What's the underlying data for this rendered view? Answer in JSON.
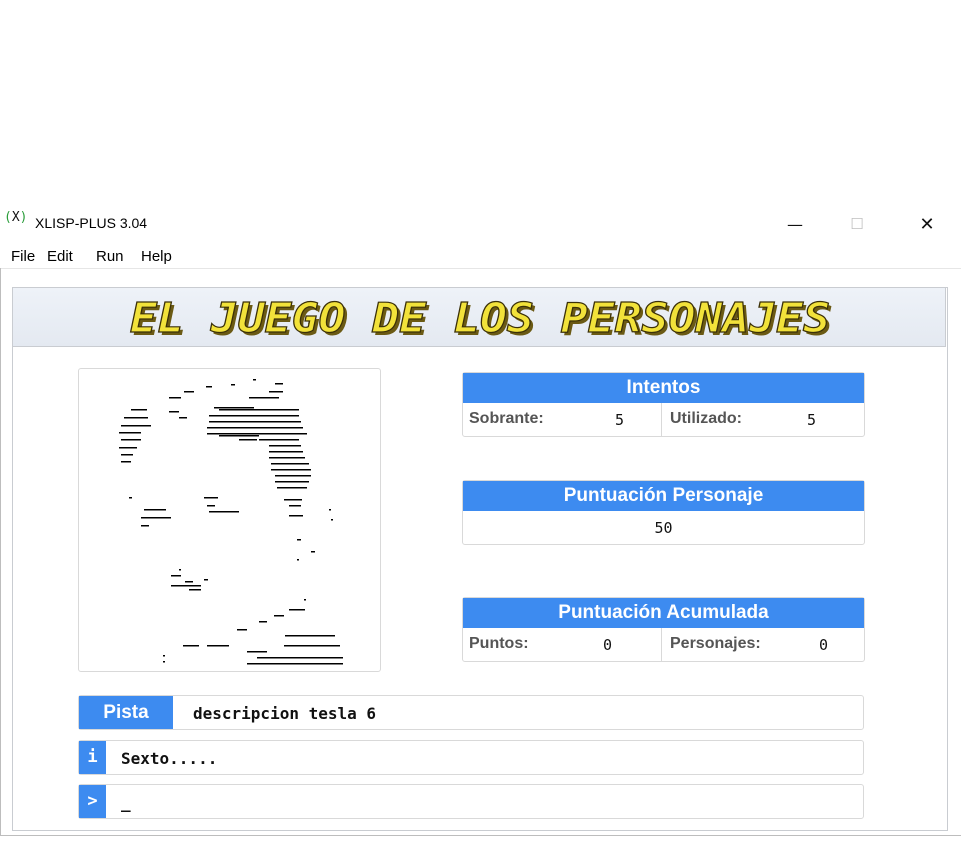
{
  "window": {
    "icon_text": "X",
    "title": "XLISP-PLUS 3.04",
    "minimize_glyph": "—",
    "maximize_glyph": "☐",
    "close_glyph": "✕"
  },
  "menu": {
    "items": [
      "File",
      "Edit",
      "Run",
      "Help"
    ]
  },
  "banner": {
    "title": "EL JUEGO DE LOS PERSONAJES"
  },
  "intentos": {
    "header": "Intentos",
    "sobrante_label": "Sobrante:",
    "sobrante_value": "5",
    "utilizado_label": "Utilizado:",
    "utilizado_value": "5"
  },
  "puntuacion_personaje": {
    "header": "Puntuación Personaje",
    "value": "50"
  },
  "puntuacion_acumulada": {
    "header": "Puntuación Acumulada",
    "puntos_label": "Puntos:",
    "puntos_value": "0",
    "personajes_label": "Personajes:",
    "personajes_value": "0"
  },
  "pista": {
    "label": "Pista",
    "text": "descripcion tesla 6"
  },
  "info": {
    "icon": "i",
    "text": "Sexto....."
  },
  "prompt": {
    "icon": ">",
    "value": "_"
  },
  "colors": {
    "accent": "#3d8bf0",
    "banner_text": "#f2e23a",
    "banner_shadow": "#6b5a14"
  },
  "icons": [
    "x-app-icon",
    "minimize-icon",
    "maximize-icon",
    "close-icon",
    "info-icon",
    "prompt-icon"
  ]
}
